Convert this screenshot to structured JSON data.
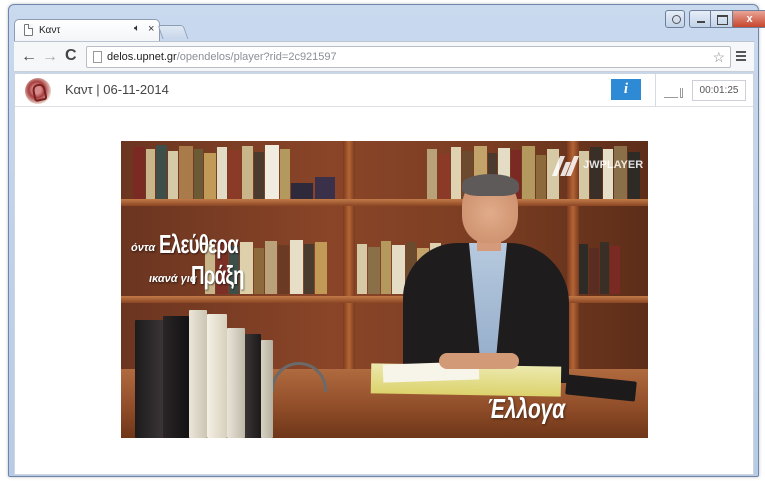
{
  "browser": {
    "tab": {
      "title": "Καντ",
      "audio_icon": "speaker-icon",
      "close": "×"
    },
    "url_host": "delos.upnet.gr",
    "url_path": "/opendelos/player?rid=2c921597",
    "window_close": "x"
  },
  "player": {
    "title": "Καντ | 06-11-2014",
    "info_label": "i",
    "time": "00:01:25"
  },
  "video": {
    "watermark": "JWPLAYER",
    "overlay_line1_small": "όντα",
    "overlay_line1_big": "Ελεύθερα",
    "overlay_line2_small": "ικανά για",
    "overlay_line2_big": "Πράξη",
    "brand_text": "Έλλογα"
  },
  "colors": {
    "info_button": "#2f8ad6",
    "close_button": "#c8452d"
  }
}
